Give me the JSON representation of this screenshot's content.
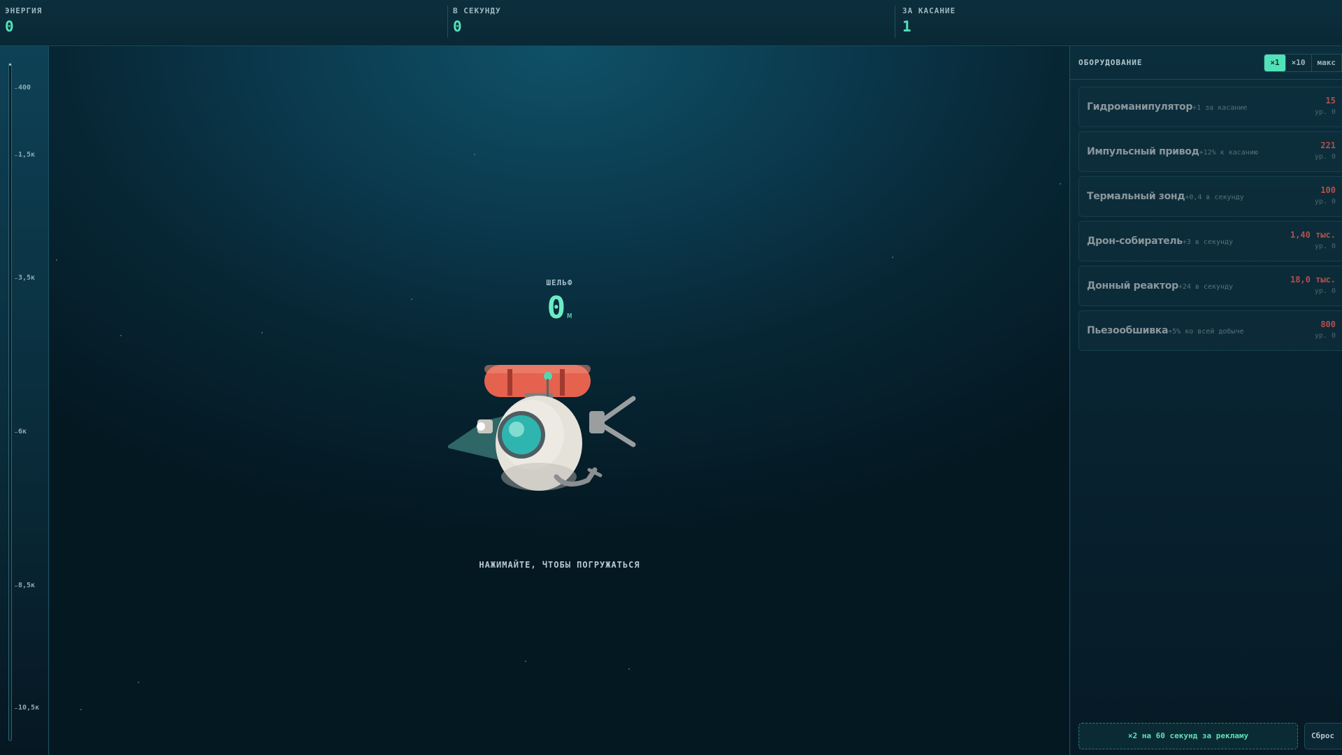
{
  "stats": {
    "energy": {
      "label": "ЭНЕРГИЯ",
      "value": "0"
    },
    "per_second": {
      "label": "В СЕКУНДУ",
      "value": "0"
    },
    "per_tap": {
      "label": "ЗА КАСАНИЕ",
      "value": "1"
    }
  },
  "ruler": {
    "progress": 0.0,
    "ticks": [
      "400",
      "1,5к",
      "3,5к",
      "6к",
      "8,5к",
      "10,5к"
    ]
  },
  "main": {
    "zone_label": "ШЕЛЬФ",
    "depth_value": "0",
    "depth_unit": "м",
    "tap_hint": "НАЖИМАЙТЕ, ЧТОБЫ ПОГРУЖАТЬСЯ"
  },
  "panel": {
    "title": "ОБОРУДОВАНИЕ",
    "multipliers": [
      {
        "label": "×1",
        "active": true
      },
      {
        "label": "×10",
        "active": false
      },
      {
        "label": "макс",
        "active": false
      }
    ],
    "upgrades": [
      {
        "name": "Гидроманипулятор",
        "desc": "+1 за касание",
        "cost": "15",
        "level": "ур. 0"
      },
      {
        "name": "Импульсный привод",
        "desc": "+12% к касанию",
        "cost": "221",
        "level": "ур. 0"
      },
      {
        "name": "Термальный зонд",
        "desc": "+0,4 в секунду",
        "cost": "100",
        "level": "ур. 0"
      },
      {
        "name": "Дрон-собиратель",
        "desc": "+3 в секунду",
        "cost": "1,40 тыс.",
        "level": "ур. 0"
      },
      {
        "name": "Донный реактор",
        "desc": "+24 в секунду",
        "cost": "18,0 тыс.",
        "level": "ур. 0"
      },
      {
        "name": "Пьезообшивка",
        "desc": "+5% ко всей добыче",
        "cost": "800",
        "level": "ур. 0"
      }
    ],
    "ad_button": "×2 на 60 секунд за рекламу",
    "reset_button": "Сброс"
  },
  "colors": {
    "accent": "#52e2b8",
    "cost_locked": "#b34f4c",
    "sub_hull": "#e5e2da",
    "sub_tank": "#e4624e",
    "sub_glass": "#2fb5b0"
  }
}
